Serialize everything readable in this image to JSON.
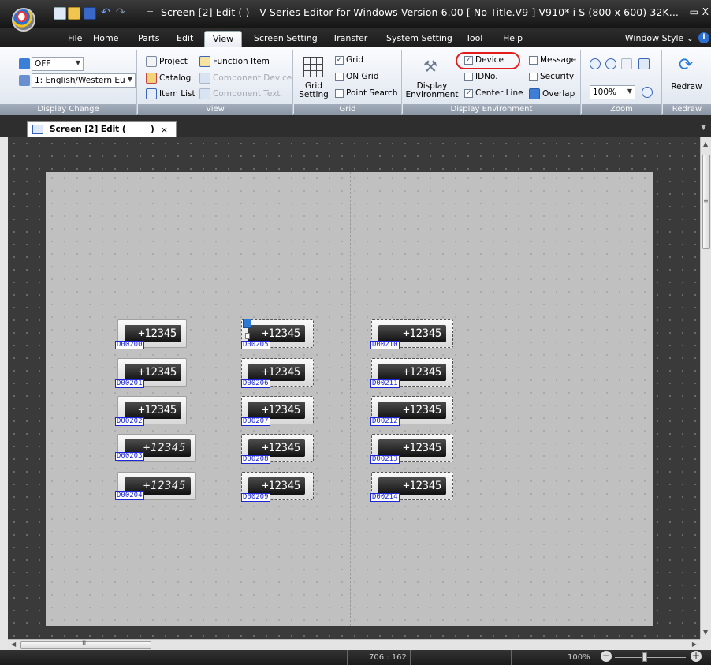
{
  "titlebar": {
    "title": "Screen [2] Edit (        ) - V Series Editor for Windows Version 6.00 [ No Title.V9 ] V910* i S (800 x 600) 32K...",
    "qa_separator": "=",
    "minimize": "_",
    "restore": "▭",
    "close": "X"
  },
  "menu": {
    "tabs": [
      "File",
      "Home",
      "Parts",
      "Edit",
      "View",
      "Screen Setting",
      "Transfer",
      "System Setting",
      "Tool",
      "Help"
    ],
    "active": "View",
    "window_style": "Window Style ⌄"
  },
  "ribbon": {
    "display_change": {
      "label": "Display Change",
      "mode_value": "OFF",
      "language_value": "1: English/Western Eu"
    },
    "view": {
      "label": "View",
      "project": "Project",
      "function_item": "Function Item",
      "catalog": "Catalog",
      "component_device": "Component Device",
      "item_list": "Item List",
      "component_text": "Component Text"
    },
    "grid": {
      "label": "Grid",
      "grid_setting_line1": "Grid",
      "grid_setting_line2": "Setting",
      "grid": "Grid",
      "grid_checked": true,
      "on_grid": "ON Grid",
      "point_search": "Point Search"
    },
    "display_environment": {
      "label": "Display Environment",
      "display_env_line1": "Display",
      "display_env_line2": "Environment",
      "device": "Device",
      "idno": "IDNo.",
      "center_line": "Center Line",
      "message": "Message",
      "security": "Security",
      "overlap": "Overlap"
    },
    "zoom": {
      "label": "Zoom",
      "value": "100%"
    },
    "redraw": {
      "label": "Redraw",
      "button": "Redraw"
    }
  },
  "document_tab": {
    "title": "Screen [2] Edit (",
    "title_end": ")",
    "close": "×"
  },
  "parts": [
    {
      "value": "+12345",
      "device": "D00200",
      "style": "normal"
    },
    {
      "value": "+12345",
      "device": "D00201",
      "style": "normal"
    },
    {
      "value": "+12345",
      "device": "D00202",
      "style": "normal"
    },
    {
      "value": "+12345",
      "device": "D00203",
      "style": "segment"
    },
    {
      "value": "+12345",
      "device": "D00204",
      "style": "segment"
    },
    {
      "value": "+12345",
      "device": "D00205",
      "style": "normal"
    },
    {
      "value": "+12345",
      "device": "D00206",
      "style": "normal"
    },
    {
      "value": "+12345",
      "device": "D00207",
      "style": "normal"
    },
    {
      "value": "+12345",
      "device": "D00208",
      "style": "normal"
    },
    {
      "value": "+12345",
      "device": "D00209",
      "style": "normal"
    },
    {
      "value": "+12345",
      "device": "D00210",
      "style": "normal"
    },
    {
      "value": "+12345",
      "device": "D00211",
      "style": "normal"
    },
    {
      "value": "+12345",
      "device": "D00212",
      "style": "normal"
    },
    {
      "value": "+12345",
      "device": "D00213",
      "style": "normal"
    },
    {
      "value": "+12345",
      "device": "D00214",
      "style": "normal"
    }
  ],
  "hscroll": {
    "grip": "III"
  },
  "status": {
    "coordinates": "706 : 162",
    "zoom": "100%"
  },
  "colors": {
    "highlight": "#e21b1b",
    "device_label": "#1d27d8",
    "workspace": "#3a3a3a",
    "screen": "#c0c0c0"
  }
}
